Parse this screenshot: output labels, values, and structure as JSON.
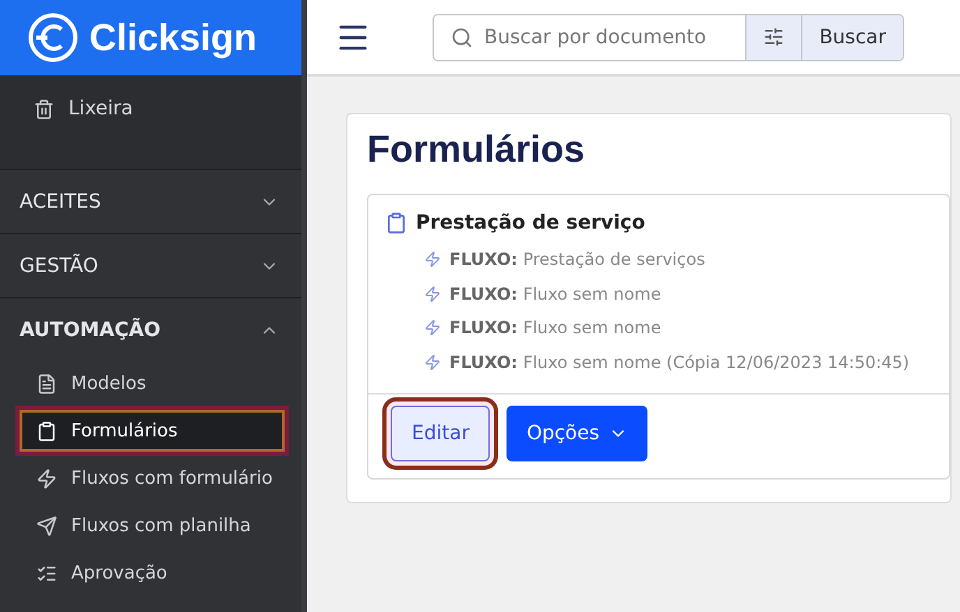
{
  "brand": {
    "name": "Clicksign"
  },
  "sidebar": {
    "top_items": [
      {
        "label": "Lixeira"
      }
    ],
    "sections": [
      {
        "label": "ACEITES",
        "expanded": false
      },
      {
        "label": "GESTÃO",
        "expanded": false
      },
      {
        "label": "AUTOMAÇÃO",
        "expanded": true,
        "items": [
          {
            "label": "Modelos",
            "selected": false,
            "highlighted": false
          },
          {
            "label": "Formulários",
            "selected": true,
            "highlighted": true
          },
          {
            "label": "Fluxos com formulário",
            "selected": false,
            "highlighted": false
          },
          {
            "label": "Fluxos com planilha",
            "selected": false,
            "highlighted": false
          },
          {
            "label": "Aprovação",
            "selected": false,
            "highlighted": false
          }
        ]
      }
    ]
  },
  "search": {
    "placeholder": "Buscar por documento",
    "button": "Buscar"
  },
  "page": {
    "title": "Formulários"
  },
  "form_card": {
    "name": "Prestação de serviço",
    "flows": [
      {
        "prefix": "FLUXO:",
        "name": "Prestação de serviços"
      },
      {
        "prefix": "FLUXO:",
        "name": "Fluxo sem nome"
      },
      {
        "prefix": "FLUXO:",
        "name": "Fluxo sem nome"
      },
      {
        "prefix": "FLUXO:",
        "name": "Fluxo sem nome (Cópia 12/06/2023 14:50:45)"
      }
    ],
    "edit_button": {
      "label": "Editar",
      "highlighted": true
    },
    "options_button": {
      "label": "Opções"
    }
  }
}
